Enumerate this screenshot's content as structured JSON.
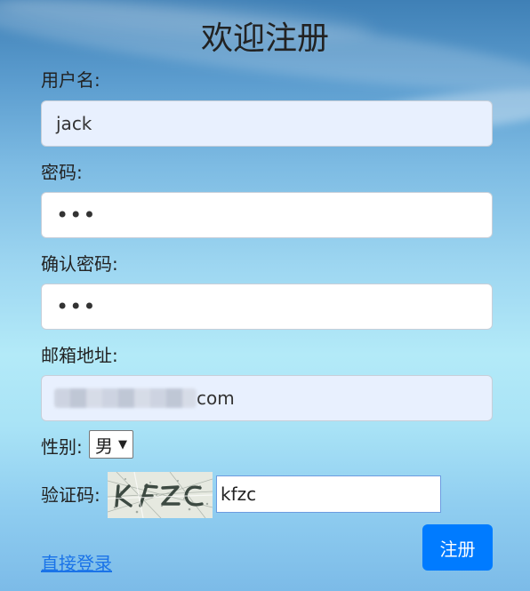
{
  "title": "欢迎注册",
  "fields": {
    "username": {
      "label": "用户名:",
      "value": "jack"
    },
    "password": {
      "label": "密码:",
      "value": "•••"
    },
    "confirm_password": {
      "label": "确认密码:",
      "value": "•••"
    },
    "email": {
      "label": "邮箱地址:",
      "value_visible_suffix": "com"
    }
  },
  "gender": {
    "label": "性别:",
    "selected": "男"
  },
  "captcha": {
    "label": "验证码:",
    "image_text": "KFZC",
    "input_value": "kfzc"
  },
  "login_link": "直接登录",
  "submit_label": "注册",
  "colors": {
    "button": "#007bff",
    "link": "#1a73e8",
    "autofill": "#e8f0fe"
  }
}
